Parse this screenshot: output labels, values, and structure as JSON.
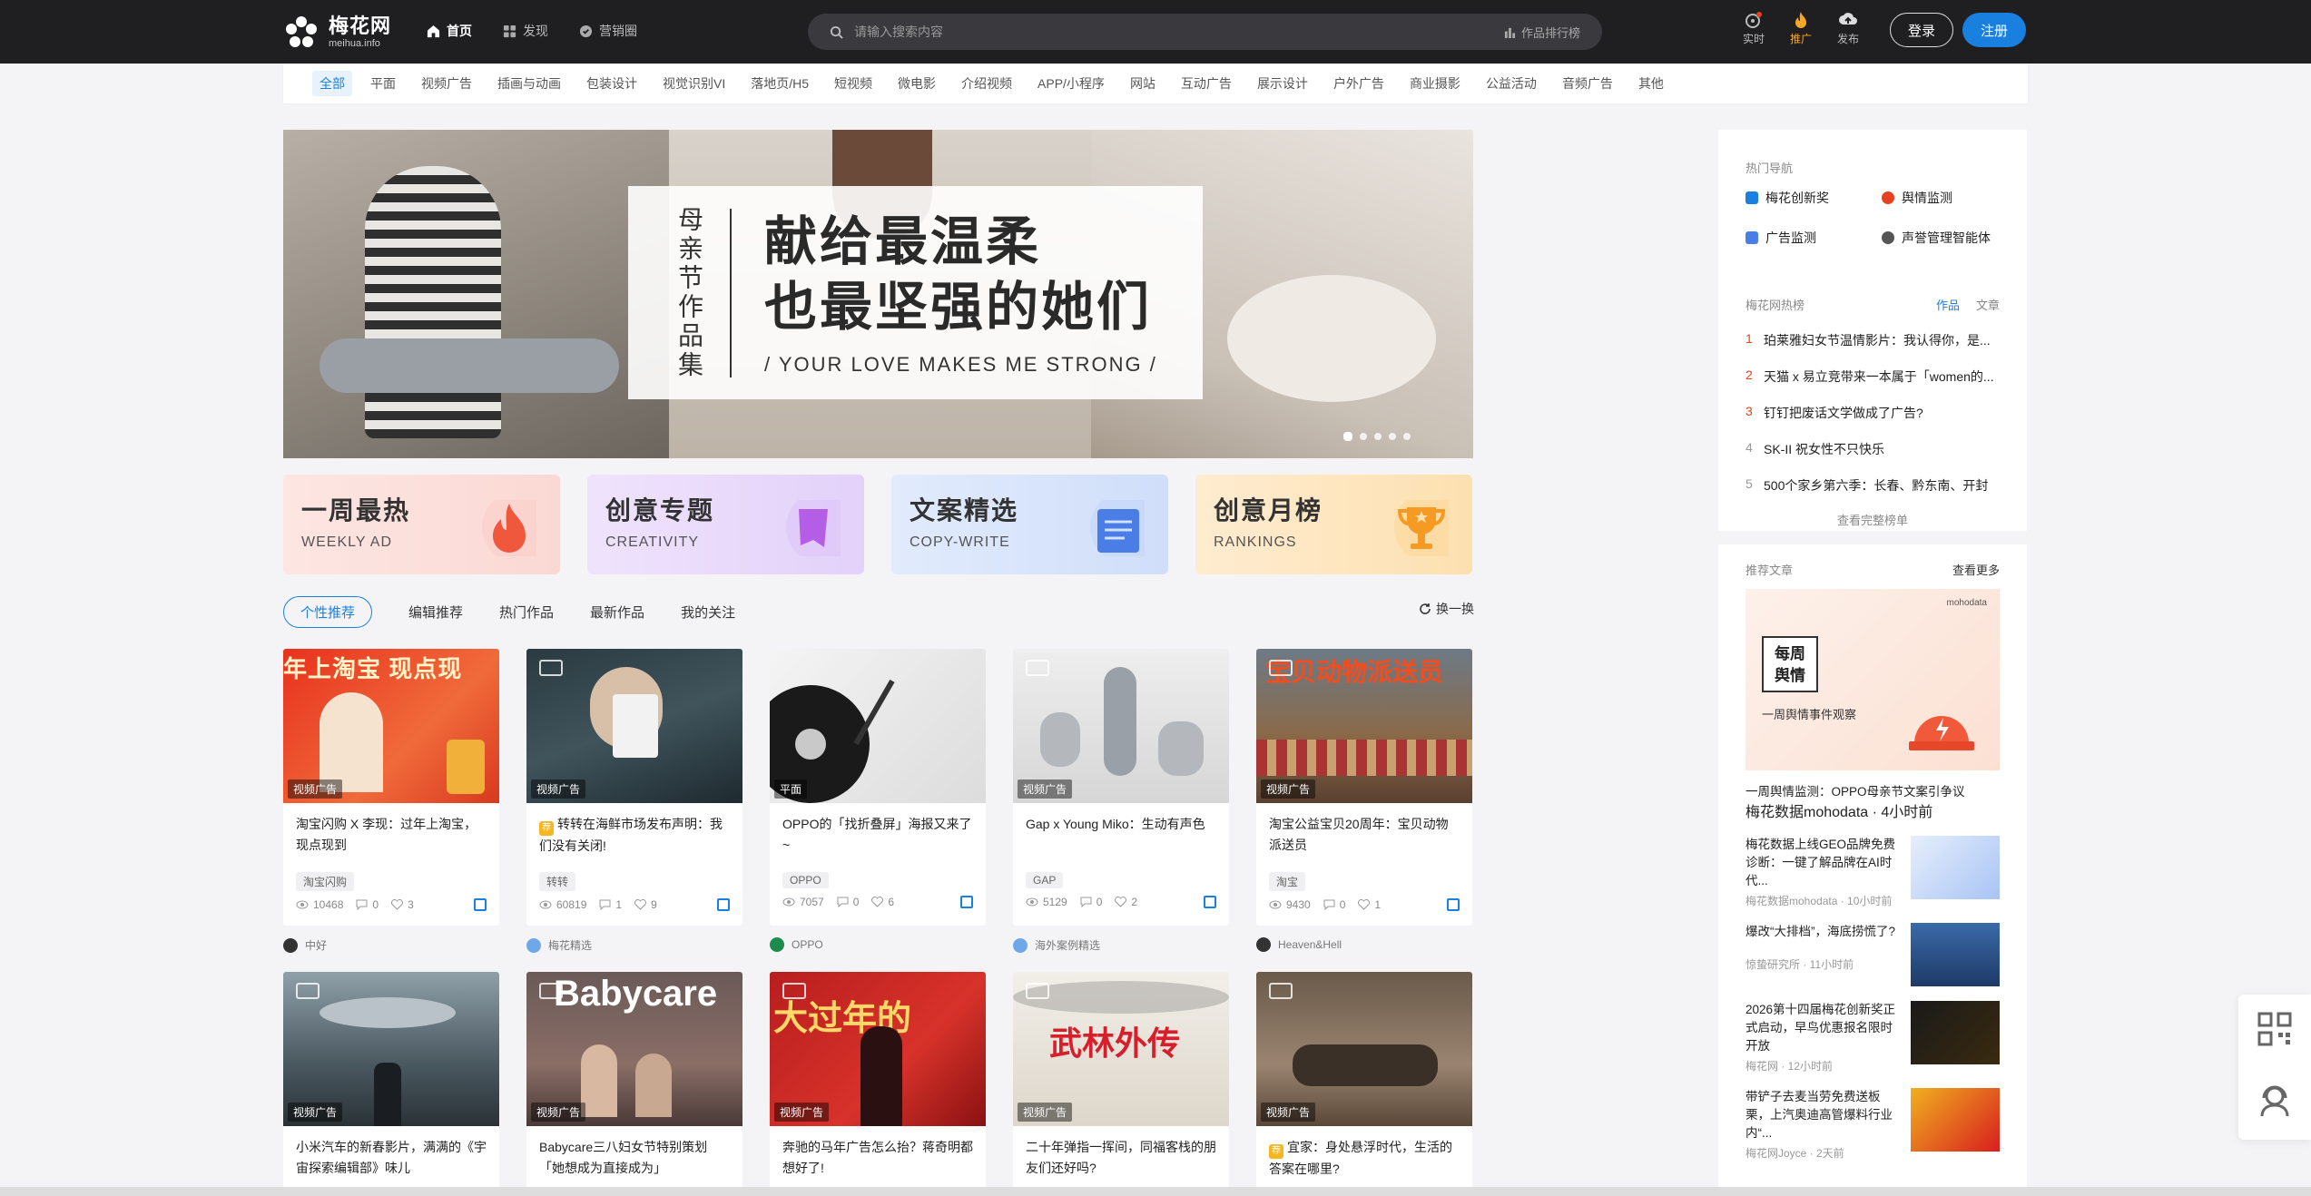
{
  "brand": {
    "name": "梅花网",
    "domain": "meihua.info",
    "accent": "#1a80e0"
  },
  "topnav": [
    {
      "label": "首页",
      "icon": "home-icon",
      "active": true
    },
    {
      "label": "发现",
      "icon": "discover-icon",
      "active": false
    },
    {
      "label": "营销圈",
      "icon": "circle-icon",
      "active": false
    }
  ],
  "search": {
    "placeholder": "请输入搜索内容",
    "rank_label": "作品排行榜"
  },
  "topicons": [
    {
      "label": "实时",
      "icon": "realtime-icon"
    },
    {
      "label": "推广",
      "icon": "fire-icon"
    },
    {
      "label": "发布",
      "icon": "cloud-upload-icon"
    }
  ],
  "auth": {
    "login": "登录",
    "register": "注册"
  },
  "categories": [
    "全部",
    "平面",
    "视频广告",
    "插画与动画",
    "包装设计",
    "视觉识别VI",
    "落地页/H5",
    "短视频",
    "微电影",
    "介绍视频",
    "APP/小程序",
    "网站",
    "互动广告",
    "展示设计",
    "户外广告",
    "商业摄影",
    "公益活动",
    "音频广告",
    "其他"
  ],
  "banner": {
    "vertical": "母亲节作品集",
    "line1": "献给最温柔",
    "line2": "也最坚强的她们",
    "english": "/ YOUR LOVE MAKES ME STRONG /"
  },
  "features": [
    {
      "title": "一周最热",
      "sub": "WEEKLY AD",
      "icon": "flame-icon",
      "bg": "#fde2df"
    },
    {
      "title": "创意专题",
      "sub": "CREATIVITY",
      "icon": "bookmark-icon",
      "bg": "#ece0fb"
    },
    {
      "title": "文案精选",
      "sub": "COPY-WRITE",
      "icon": "document-icon",
      "bg": "#dde8fb"
    },
    {
      "title": "创意月榜",
      "sub": "RANKINGS",
      "icon": "trophy-icon",
      "bg": "#fde9c8"
    }
  ],
  "tabs": [
    "个性推荐",
    "编辑推荐",
    "热门作品",
    "最新作品",
    "我的关注"
  ],
  "refresh_label": "换一换",
  "cards_row1": [
    {
      "tag": "视频广告",
      "title": "淘宝闪购 X 李现：过年上淘宝，现点现到",
      "chip": "淘宝闪购",
      "views": "10468",
      "comments": "0",
      "likes": "3",
      "author": "中好",
      "badge": false
    },
    {
      "tag": "视频广告",
      "title": "转转在海鲜市场发布声明：我们没有关闭!",
      "chip": "转转",
      "views": "60819",
      "comments": "1",
      "likes": "9",
      "author": "梅花精选",
      "badge": true
    },
    {
      "tag": "平面",
      "title": "OPPO的「找折叠屏」海报又来了~",
      "chip": "OPPO",
      "views": "7057",
      "comments": "0",
      "likes": "6",
      "author": "OPPO",
      "badge": false
    },
    {
      "tag": "视频广告",
      "title": "Gap x Young Miko：生动有声色",
      "chip": "GAP",
      "views": "5129",
      "comments": "0",
      "likes": "2",
      "author": "海外案例精选",
      "badge": false
    },
    {
      "tag": "视频广告",
      "title": "淘宝公益宝贝20周年：宝贝动物派送员",
      "chip": "淘宝",
      "views": "9430",
      "comments": "0",
      "likes": "1",
      "author": "Heaven&Hell",
      "badge": false
    }
  ],
  "cards_row2": [
    {
      "tag": "视频广告",
      "title": "小米汽车的新春影片，满满的《宇宙探索编辑部》味儿",
      "badge": false
    },
    {
      "tag": "视频广告",
      "title": "Babycare三八妇女节特别策划「她想成为直接成为」",
      "badge": false
    },
    {
      "tag": "视频广告",
      "title": "奔驰的马年广告怎么抬？蒋奇明都想好了!",
      "badge": false
    },
    {
      "tag": "视频广告",
      "title": "二十年弹指一挥间，同福客栈的朋友们还好吗?",
      "badge": false
    },
    {
      "tag": "视频广告",
      "title": "宜家：身处悬浮时代，生活的答案在哪里?",
      "badge": true
    }
  ],
  "thumb_text": {
    "c1": "年上淘宝 现点现",
    "c5": "宝贝动物派送员",
    "r2c2": "Babycare",
    "r2c3": "大过年的",
    "r2c4": "武林外传"
  },
  "side": {
    "hot_nav_title": "热门导航",
    "hot_nav": [
      {
        "label": "梅花创新奖",
        "color": "#1a80e0"
      },
      {
        "label": "舆情监测",
        "color": "#e6421e"
      },
      {
        "label": "广告监测",
        "color": "#1a80e0"
      },
      {
        "label": "声誉管理智能体",
        "color": "#555"
      }
    ],
    "hot_list_title": "梅花网热榜",
    "hot_switch": [
      "作品",
      "文章"
    ],
    "hot_list": [
      {
        "n": "1",
        "t": "珀莱雅妇女节温情影片：我认得你，是..."
      },
      {
        "n": "2",
        "t": "天猫 x 易立竞带来一本属于「women的..."
      },
      {
        "n": "3",
        "t": "钉钉把废话文学做成了广告?"
      },
      {
        "n": "4",
        "t": "SK-II 祝女性不只快乐"
      },
      {
        "n": "5",
        "t": "500个家乡第六季：长春、黔东南、开封"
      }
    ],
    "hot_more": "查看完整榜单",
    "articles_title": "推荐文章",
    "articles_more": "查看更多",
    "poster": {
      "brand": "mohodata",
      "title1": "每周",
      "title2": "舆情",
      "caption": "一周舆情事件观察"
    },
    "articles": [
      {
        "title": "一周舆情监测：OPPO母亲节文案引争议",
        "meta": "梅花数据mohodata · 4小时前"
      },
      {
        "title": "梅花数据上线GEO品牌免费诊断：一键了解品牌在AI时代...",
        "meta": "梅花数据mohodata · 10小时前"
      },
      {
        "title": "爆改“大排档”，海底捞慌了?",
        "meta": "惊蛰研究所 · 11小时前"
      },
      {
        "title": "2026第十四届梅花创新奖正式启动，早鸟优惠报名限时开放",
        "meta": "梅花网 · 12小时前"
      },
      {
        "title": "带铲子去麦当劳免费送板栗，上汽奥迪高管爆料行业内“...",
        "meta": "梅花网Joyce · 2天前"
      }
    ]
  }
}
